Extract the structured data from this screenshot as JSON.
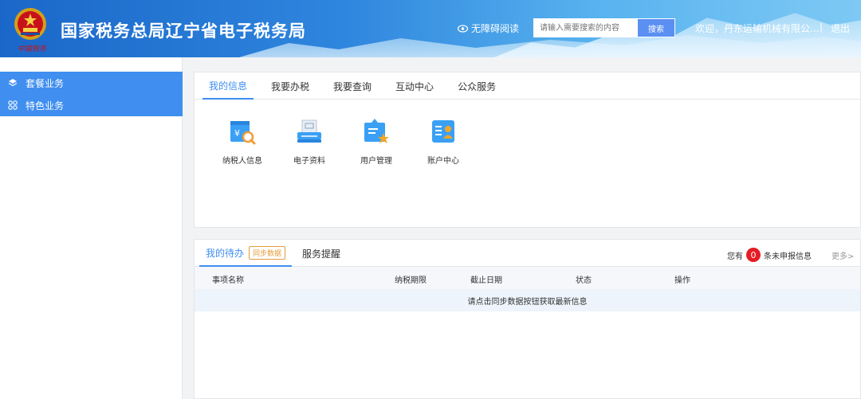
{
  "header": {
    "title": "国家税务总局辽宁省电子税务局",
    "emblem_caption": "中国税务",
    "accessible_label": "无障碍阅读",
    "search_placeholder": "请输入需要搜索的内容",
    "search_button": "搜索",
    "welcome": "欢迎，丹东运输机械有限公...",
    "separator": "|",
    "logout": "退出"
  },
  "sidebar": {
    "items": [
      {
        "label": "套餐业务",
        "icon": "layers-icon"
      },
      {
        "label": "特色业务",
        "icon": "grid-icon"
      }
    ]
  },
  "main": {
    "tabs": [
      {
        "label": "我的信息",
        "active": true
      },
      {
        "label": "我要办税",
        "active": false
      },
      {
        "label": "我要查询",
        "active": false
      },
      {
        "label": "互动中心",
        "active": false
      },
      {
        "label": "公众服务",
        "active": false
      }
    ],
    "apps": [
      {
        "label": "纳税人信息",
        "icon": "taxpayer-search-icon"
      },
      {
        "label": "电子资料",
        "icon": "scanner-icon"
      },
      {
        "label": "用户管理",
        "icon": "user-management-icon"
      },
      {
        "label": "账户中心",
        "icon": "account-center-icon"
      }
    ]
  },
  "todo": {
    "tab_mine": "我的待办",
    "sync_badge": "同步数据",
    "tab_reminder": "服务提醒",
    "pending_prefix": "您有",
    "pending_count": "0",
    "pending_suffix": "条未申报信息",
    "more": "更多>",
    "columns": [
      "事项名称",
      "纳税期限",
      "截止日期",
      "状态",
      "操作"
    ],
    "empty_message": "请点击同步数据按钮获取最新信息"
  },
  "colors": {
    "accent": "#3f8ef0",
    "header_start": "#1a67c9",
    "header_end": "#7ec9f4",
    "badge_red": "#e51c23",
    "sync_orange": "#e39b3c"
  }
}
